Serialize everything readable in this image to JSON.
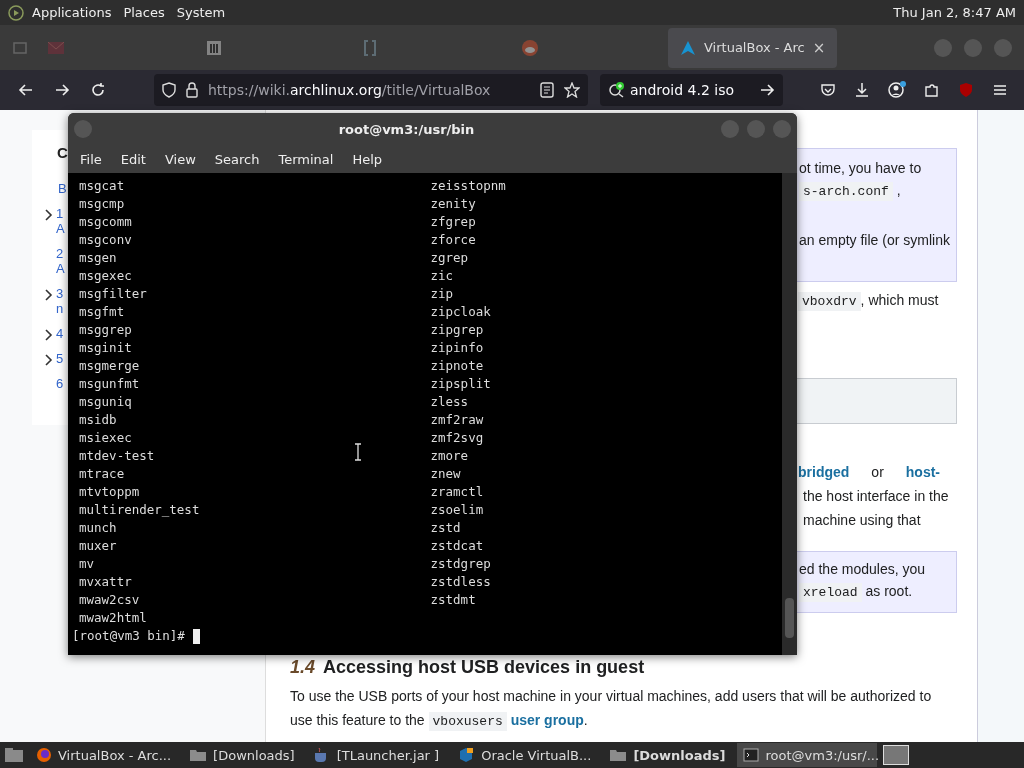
{
  "top_panel": {
    "menus": [
      "Applications",
      "Places",
      "System"
    ],
    "clock": "Thu Jan 2, 8:47 AM"
  },
  "browser": {
    "tabs": [
      {
        "kind": "envelope",
        "selected": false
      },
      {
        "kind": "pillars",
        "selected": false
      },
      {
        "kind": "bracket",
        "selected": false
      },
      {
        "kind": "round",
        "selected": false
      },
      {
        "kind": "triangle",
        "label": "VirtualBox - Arc",
        "close": "×",
        "selected": true
      }
    ],
    "url_parts": [
      {
        "text": "https://wiki.",
        "highlight": false
      },
      {
        "text": "archlinux.org",
        "highlight": true
      },
      {
        "text": "/title/VirtualBox",
        "highlight": false
      }
    ],
    "search_value": "android 4.2 iso"
  },
  "wiki": {
    "toc": {
      "heading": "C",
      "first": "B",
      "items": [
        {
          "number": "1",
          "text": "A",
          "expandable": true
        },
        {
          "number": "2",
          "text": "A",
          "expandable": false
        },
        {
          "number": "3",
          "text": "n",
          "expandable": true
        },
        {
          "number": "4",
          "expandable": true
        },
        {
          "number": "5",
          "expandable": true
        },
        {
          "number": "6",
          "expandable": false
        }
      ]
    },
    "note1": {
      "line1": "ot time, you have to",
      "code": "s-arch.conf",
      "after_code": ",",
      "line3": "an empty file (or symlink"
    },
    "para1": {
      "code": "vboxdrv",
      "text": ", which must"
    },
    "para2": {
      "link1": "bridged",
      "or": "or",
      "link2": "host-",
      "line2": "the host interface in the",
      "line3": "machine using that"
    },
    "note2": {
      "line1": "ed the modules, you",
      "code": "xreload",
      "text": "as root."
    },
    "section": {
      "number": "1.4",
      "title": "Accessing host USB devices in guest"
    },
    "para3": {
      "text": "To use the USB ports of your host machine in your virtual machines, add users that will be authorized to use this feature to the",
      "code": "vboxusers",
      "link": "user group",
      "end": "."
    }
  },
  "terminal": {
    "title": "root@vm3:/usr/bin",
    "menus": [
      "File",
      "Edit",
      "View",
      "Search",
      "Terminal",
      "Help"
    ],
    "left": [
      "msgcat",
      "msgcmp",
      "msgcomm",
      "msgconv",
      "msgen",
      "msgexec",
      "msgfilter",
      "msgfmt",
      "msggrep",
      "msginit",
      "msgmerge",
      "msgunfmt",
      "msguniq",
      "msidb",
      "msiexec",
      "mtdev-test",
      "mtrace",
      "mtvtoppm",
      "multirender_test",
      "munch",
      "muxer",
      "mv",
      "mvxattr",
      "mwaw2csv",
      "mwaw2html"
    ],
    "right": [
      "zeisstopnm",
      "zenity",
      "zfgrep",
      "zforce",
      "zgrep",
      "zic",
      "zip",
      "zipcloak",
      "zipgrep",
      "zipinfo",
      "zipnote",
      "zipsplit",
      "zless",
      "zmf2raw",
      "zmf2svg",
      "zmore",
      "znew",
      "zramctl",
      "zsoelim",
      "zstd",
      "zstdcat",
      "zstdgrep",
      "zstdless",
      "zstdmt"
    ],
    "prompt": "[root@vm3 bin]#"
  },
  "taskbar": [
    {
      "kind": "browser",
      "label": "VirtualBox - Arc...",
      "attention": false,
      "active": false
    },
    {
      "kind": "folder",
      "label": "[Downloads]",
      "attention": false,
      "active": false
    },
    {
      "kind": "java",
      "label": "[TLauncher.jar ]",
      "attention": false,
      "active": false
    },
    {
      "kind": "vbox",
      "label": "Oracle VirtualB...",
      "attention": false,
      "active": false
    },
    {
      "kind": "folder",
      "label": "[Downloads]",
      "attention": true,
      "active": false
    },
    {
      "kind": "terminal",
      "label": "root@vm3:/usr/...",
      "attention": false,
      "active": true
    }
  ]
}
